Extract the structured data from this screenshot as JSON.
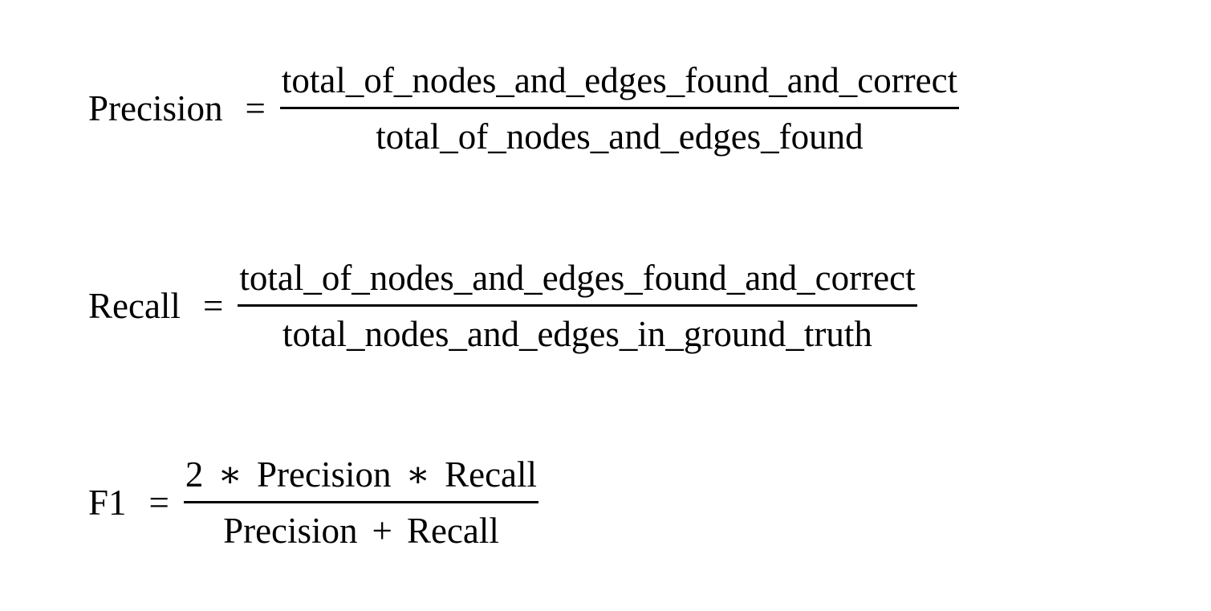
{
  "equations": {
    "precision": {
      "lhs": "Precision",
      "equals": "=",
      "numerator": "total_of_nodes_and_edges_found_and_correct",
      "denominator": "total_of_nodes_and_edges_found"
    },
    "recall": {
      "lhs": "Recall",
      "equals": "=",
      "numerator": "total_of_nodes_and_edges_found_and_correct",
      "denominator": "total_nodes_and_edges_in_ground_truth"
    },
    "f1": {
      "lhs": "F1",
      "equals": "=",
      "numerator": {
        "factor": "2",
        "op1": "∗",
        "term1": "Precision",
        "op2": "∗",
        "term2": "Recall"
      },
      "denominator": {
        "term1": "Precision",
        "op": "+",
        "term2": "Recall"
      }
    }
  }
}
